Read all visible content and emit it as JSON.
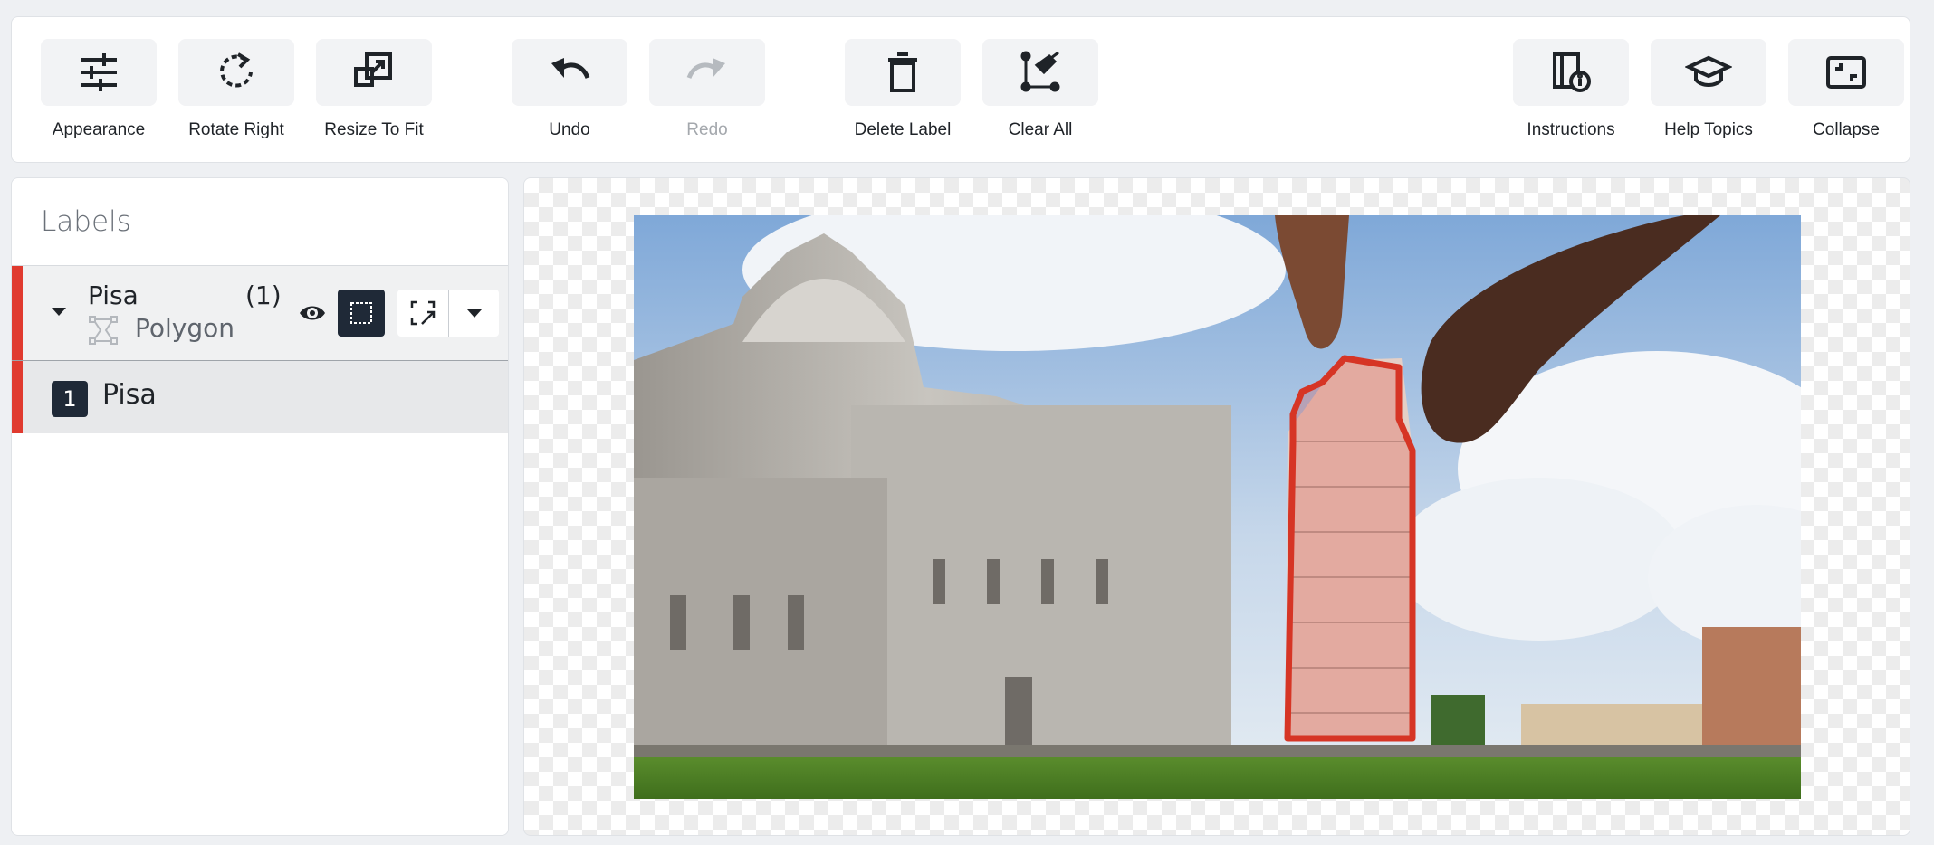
{
  "toolbar": {
    "appearance": "Appearance",
    "rotate_right": "Rotate Right",
    "resize_to_fit": "Resize To Fit",
    "undo": "Undo",
    "redo": "Redo",
    "delete_label": "Delete Label",
    "clear_all": "Clear All",
    "instructions": "Instructions",
    "help_topics": "Help Topics",
    "collapse": "Collapse"
  },
  "sidebar": {
    "title": "Labels",
    "class": {
      "name": "Pisa",
      "count": "(1)",
      "type": "Polygon"
    },
    "instances": [
      {
        "index": "1",
        "name": "Pisa"
      }
    ]
  },
  "colors": {
    "label_accent": "#e03a2f",
    "dark_button": "#1f2937"
  },
  "icons": [
    "sliders-icon",
    "rotate-right-icon",
    "resize-to-fit-icon",
    "undo-icon",
    "redo-icon",
    "trash-icon",
    "clear-all-icon",
    "instructions-icon",
    "graduation-cap-icon",
    "collapse-icon",
    "eye-icon",
    "fill-icon",
    "polygon-icon",
    "caret-down-icon"
  ]
}
